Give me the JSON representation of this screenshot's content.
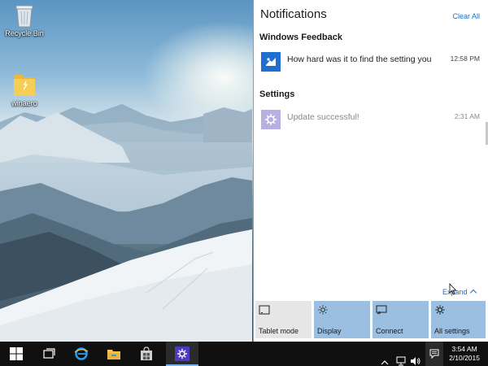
{
  "desktop": {
    "icons": [
      {
        "label": "Recycle Bin",
        "icon": "recycle-bin-icon"
      },
      {
        "label": "winaero",
        "icon": "folder-icon"
      }
    ]
  },
  "action_center": {
    "title": "Notifications",
    "clear_all": "Clear All",
    "groups": [
      {
        "title": "Windows Feedback",
        "icon": "feedback-icon",
        "notifications": [
          {
            "text": "How hard was it to find the setting you",
            "time": "12:58 PM"
          }
        ]
      },
      {
        "title": "Settings",
        "icon": "settings-gear-icon",
        "notifications": [
          {
            "text": "Update successful!",
            "time": "2:31 AM"
          }
        ]
      }
    ],
    "expand_label": "Expand",
    "quick_actions": [
      {
        "label": "Tablet mode",
        "icon": "tablet-mode-icon",
        "active": false
      },
      {
        "label": "Display",
        "icon": "brightness-icon",
        "active": true
      },
      {
        "label": "Connect",
        "icon": "connect-icon",
        "active": true
      },
      {
        "label": "All settings",
        "icon": "gear-icon",
        "active": true
      }
    ]
  },
  "taskbar": {
    "items": [
      "start-icon",
      "task-view-icon",
      "edge-icon",
      "file-explorer-icon",
      "store-icon",
      "settings-icon"
    ],
    "tray_icons": [
      "show-hidden-icons-icon",
      "network-icon",
      "volume-icon",
      "action-center-icon"
    ],
    "clock": {
      "time": "3:54 AM",
      "date": "2/10/2015"
    }
  },
  "colors": {
    "accent": "#1a6fc2",
    "quick_active": "#9bbfe0",
    "quick_inactive": "#e6e6e6",
    "taskbar": "#101010",
    "settings_purple": "#4d3bbf"
  }
}
